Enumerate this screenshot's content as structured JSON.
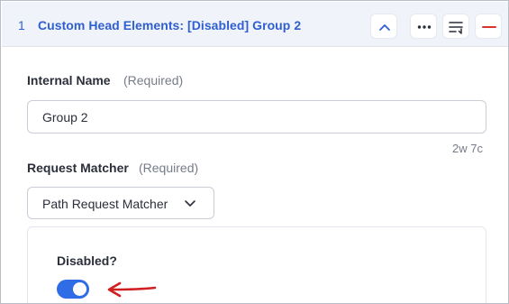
{
  "header": {
    "index": "1",
    "title": "Custom Head Elements: [Disabled] Group 2",
    "buttons": {
      "collapse": "chevron-up-icon",
      "more": "more-horizontal-icon",
      "sort": "sort-lines-icon",
      "remove": "minus-icon"
    },
    "accent_color": "#2f5fd0",
    "remove_color": "#d9342b"
  },
  "internal_name": {
    "label": "Internal Name",
    "required_note": "(Required)",
    "value": "Group 2",
    "counter": "2w 7c"
  },
  "request_matcher": {
    "label": "Request Matcher",
    "required_note": "(Required)",
    "selected": "Path Request Matcher"
  },
  "disabled": {
    "label": "Disabled?",
    "checked": true,
    "toggle_color": "#2f6ce5"
  },
  "annotation": {
    "arrow_color": "#d01f1f"
  }
}
